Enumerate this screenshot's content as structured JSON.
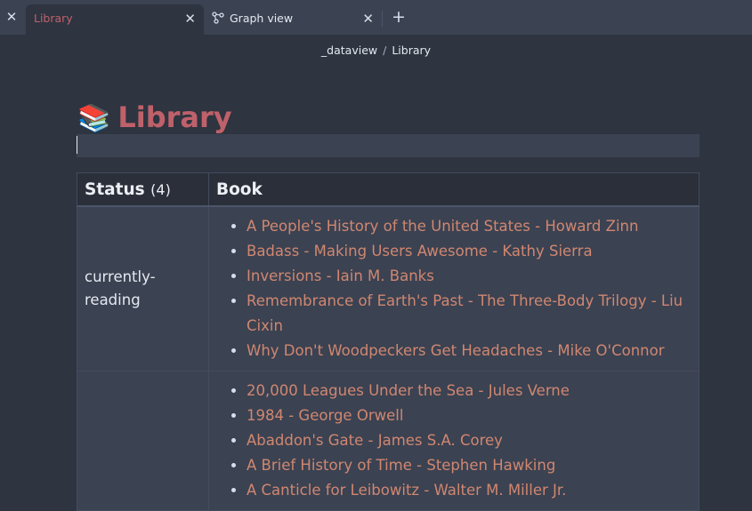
{
  "tabs": [
    {
      "label": "Library",
      "active": true
    },
    {
      "label": "Graph view",
      "active": false
    }
  ],
  "breadcrumb": [
    "_dataview",
    "Library"
  ],
  "breadcrumb_sep": "/",
  "title": {
    "emoji": "📚",
    "text": "Library"
  },
  "table": {
    "headers": {
      "status": "Status",
      "count": "(4)",
      "book": "Book"
    },
    "rows": [
      {
        "status": "currently-reading",
        "books": [
          "A People's History of the United States - Howard Zinn",
          "Badass - Making Users Awesome - Kathy Sierra",
          "Inversions - Iain M. Banks",
          "Remembrance of Earth's Past - The Three-Body Trilogy - Liu Cixin",
          "Why Don't Woodpeckers Get Headaches - Mike O'Connor"
        ]
      },
      {
        "status": "",
        "books": [
          "20,000 Leagues Under the Sea - Jules Verne",
          "1984 - George Orwell",
          "Abaddon's Gate - James S.A. Corey",
          "A Brief History of Time - Stephen Hawking",
          "A Canticle for Leibowitz - Walter M. Miller Jr."
        ]
      }
    ]
  },
  "colors": {
    "accent": "#bf616a",
    "link": "#d08770",
    "background": "#2e3440"
  }
}
